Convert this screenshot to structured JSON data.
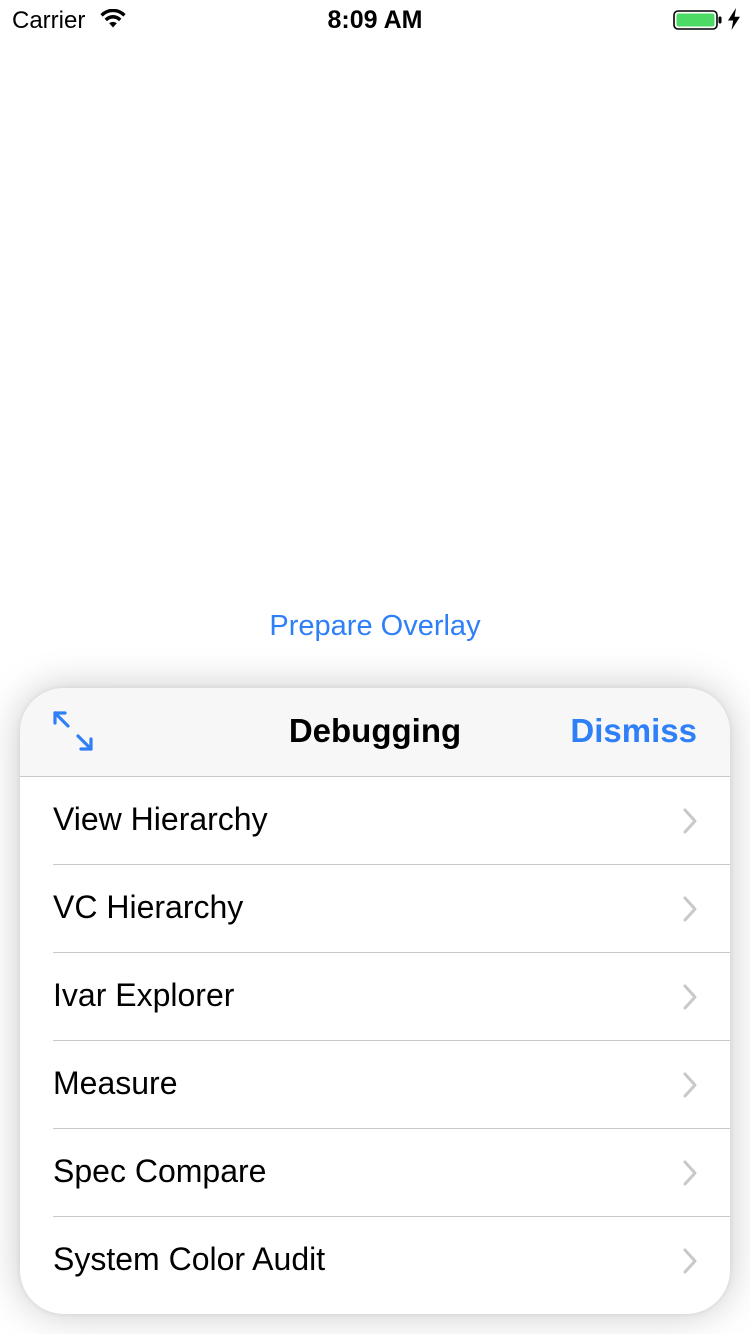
{
  "status_bar": {
    "carrier": "Carrier",
    "time": "8:09 AM",
    "wifi_icon": "wifi-icon",
    "battery_icon": "battery-icon",
    "battery_level": 1.0,
    "charging_icon": "bolt-icon",
    "battery_color": "#4cd964"
  },
  "main": {
    "prepare_link": "Prepare Overlay",
    "accent_color": "#2f7ff7"
  },
  "panel": {
    "title": "Debugging",
    "dismiss_label": "Dismiss",
    "expand_icon": "expand-arrows-icon",
    "items": [
      {
        "label": "View Hierarchy"
      },
      {
        "label": "VC Hierarchy"
      },
      {
        "label": "Ivar Explorer"
      },
      {
        "label": "Measure"
      },
      {
        "label": "Spec Compare"
      },
      {
        "label": "System Color Audit"
      }
    ]
  }
}
